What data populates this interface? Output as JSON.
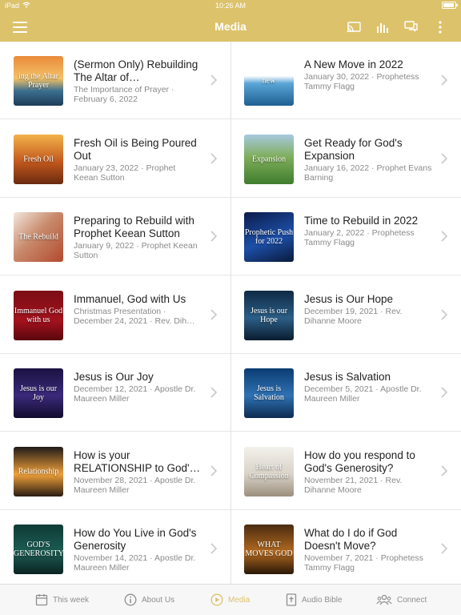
{
  "status": {
    "carrier": "iPad",
    "time": "10:26 AM"
  },
  "header": {
    "title": "Media"
  },
  "items": [
    {
      "title": "(Sermon Only) Rebuilding The Altar of…",
      "meta": "The Importance of Prayer · February 6, 2022",
      "thumb_text": "ing the Altar Prayer",
      "thumb_bg": "linear-gradient(180deg,#e98a3a 0%,#f5c266 45%,#3b6f8f 70%,#1e3b58 100%)"
    },
    {
      "title": "A New Move in 2022",
      "meta": "January 30, 2022 · Prophetess Tammy Flagg",
      "thumb_text": "new",
      "thumb_bg": "linear-gradient(180deg,#ffffff 0%,#ffffff 40%,#5aa6d6 55%,#1f5f92 100%)"
    },
    {
      "title": "Fresh Oil is Being Poured Out",
      "meta": "January 23, 2022 · Prophet Keean Sutton",
      "thumb_text": "Fresh Oil",
      "thumb_bg": "linear-gradient(180deg,#f3b24a 0%,#c2581d 55%,#6a2a10 100%)"
    },
    {
      "title": "Get Ready for God's Expansion",
      "meta": "January 16, 2022 · Prophet Evans Barning",
      "thumb_text": "Expansion",
      "thumb_bg": "linear-gradient(180deg,#a7c8e0 0%,#7fae5a 45%,#3f7d2e 100%)"
    },
    {
      "title": "Preparing to Rebuild with Prophet Keean Sutton",
      "meta": "January 9, 2022 · Prophet Keean Sutton",
      "thumb_text": "The Rebuild",
      "thumb_bg": "linear-gradient(135deg,#f2e7df 0%,#c98b6d 45%,#b24a2e 100%)"
    },
    {
      "title": "Time to Rebuild in 2022",
      "meta": "January 2, 2022 · Prophetess Tammy Flagg",
      "thumb_text": "Prophetic Push for 2022",
      "thumb_bg": "linear-gradient(160deg,#0b1c4a 0%,#1d4fa8 55%,#0a1a3c 100%)"
    },
    {
      "title": "Immanuel, God with Us",
      "meta": "Christmas Presentation · December 24, 2021 · Rev. Dih…",
      "thumb_text": "Immanuel God with us",
      "thumb_bg": "linear-gradient(180deg,#7a0d14 0%,#a3121e 60%,#5a070e 100%)"
    },
    {
      "title": "Jesus is Our Hope",
      "meta": "December 19, 2021 · Rev. Dihanne Moore",
      "thumb_text": "Jesus is our Hope",
      "thumb_bg": "linear-gradient(180deg,#0e2a45 0%,#2c5e86 55%,#0a1c2f 100%)"
    },
    {
      "title": "Jesus is Our Joy",
      "meta": "December 12, 2021 · Apostle Dr. Maureen Miller",
      "thumb_text": "Jesus is our Joy",
      "thumb_bg": "linear-gradient(180deg,#1b1242 0%,#3a2a7a 55%,#120b2c 100%)"
    },
    {
      "title": "Jesus is Salvation",
      "meta": "December 5, 2021 · Apostle Dr. Maureen Miller",
      "thumb_text": "Jesus is Salvation",
      "thumb_bg": "linear-gradient(180deg,#0b3c72 0%,#2f72b3 55%,#0d2b50 100%)"
    },
    {
      "title": "How is your RELATIONSHIP to God'…",
      "meta": "November 28, 2021 · Apostle Dr. Maureen Miller",
      "thumb_text": "Relationship",
      "thumb_bg": "linear-gradient(180deg,#1f1a18 0%,#f0a13a 55%,#2a1c12 100%)"
    },
    {
      "title": "How do you respond to God's Generosity?",
      "meta": "November 21, 2021 · Rev. Dihanne Moore",
      "thumb_text": "Heart of Compassion",
      "thumb_bg": "linear-gradient(180deg,#f3f1ec 0%,#d9d3c8 55%,#9b8f7d 100%)"
    },
    {
      "title": "How do You Live in God's Generosity",
      "meta": "November 14, 2021 · Apostle Dr. Maureen Miller",
      "thumb_text": "GOD'S GENEROSITY",
      "thumb_bg": "linear-gradient(180deg,#0f3a36 0%,#1c5d53 55%,#0b2321 100%)"
    },
    {
      "title": "What do I do if God Doesn't Move?",
      "meta": "November 7, 2021 · Prophetess Tammy Flagg",
      "thumb_text": "WHAT MOVES GOD",
      "thumb_bg": "linear-gradient(180deg,#4a2b10 0%,#b26a20 55%,#2a1708 100%)"
    }
  ],
  "tabs": [
    {
      "label": "This week",
      "icon": "calendar-icon",
      "active": false
    },
    {
      "label": "About Us",
      "icon": "info-icon",
      "active": false
    },
    {
      "label": "Media",
      "icon": "play-icon",
      "active": true
    },
    {
      "label": "Audio Bible",
      "icon": "bible-icon",
      "active": false
    },
    {
      "label": "Connect",
      "icon": "people-icon",
      "active": false
    }
  ],
  "colors": {
    "accent": "#dcc26a",
    "divider": "#e6e6e6",
    "meta": "#8a8a8a"
  }
}
